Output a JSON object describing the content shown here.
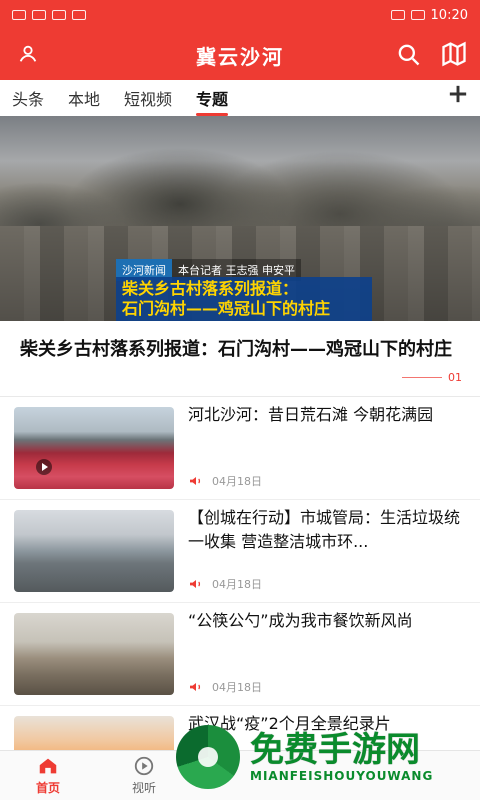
{
  "status": {
    "time": "10:20"
  },
  "app": {
    "title": "冀云沙河"
  },
  "tabs": [
    {
      "label": "头条"
    },
    {
      "label": "本地"
    },
    {
      "label": "短视频"
    },
    {
      "label": "专题"
    }
  ],
  "hero": {
    "badge": "沙河新闻",
    "reporter": "本台记者  王志强  申安平",
    "headline_line1": "柴关乡古村落系列报道：",
    "headline_line2": "石门沟村——鸡冠山下的村庄"
  },
  "feature": {
    "title": "柴关乡古村落系列报道：石门沟村——鸡冠山下的村庄",
    "index": "01"
  },
  "list": [
    {
      "title": "河北沙河：昔日荒石滩  今朝花满园",
      "date": "04月18日"
    },
    {
      "title": "【创城在行动】市城管局：生活垃圾统一收集  营造整洁城市环...",
      "date": "04月18日"
    },
    {
      "title": "“公筷公勺”成为我市餐饮新风尚",
      "date": "04月18日"
    },
    {
      "title": "武汉战“疫”2个月全景纪录片"
    }
  ],
  "bottom_nav": [
    {
      "label": "首页"
    },
    {
      "label": "视听"
    }
  ],
  "watermark": {
    "title": "免费手游网",
    "subtitle": "MIANFEISHOUYOUWANG"
  },
  "colors": {
    "brand": "#ee3b33",
    "accent": "#ee3b33",
    "watermark": "#0a8b2c"
  }
}
